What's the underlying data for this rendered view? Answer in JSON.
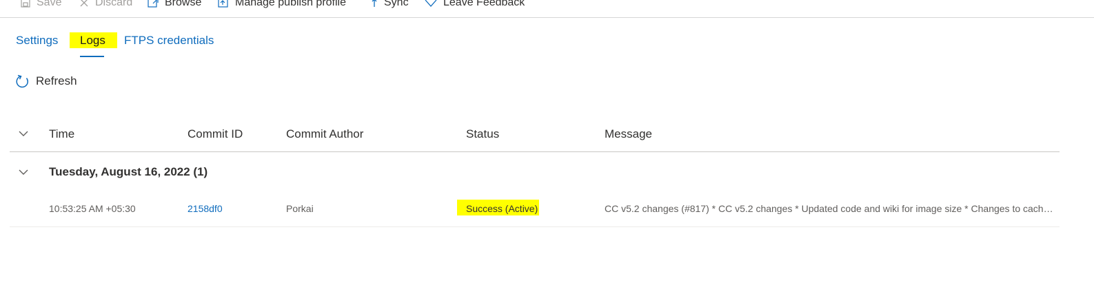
{
  "toolbar": {
    "items": [
      {
        "label": "Save",
        "icon": "save-icon",
        "enabled": false
      },
      {
        "label": "Discard",
        "icon": "discard-icon",
        "enabled": false
      },
      {
        "label": "Browse",
        "icon": "browse-icon",
        "enabled": true
      },
      {
        "label": "Manage publish profile",
        "icon": "publish-profile-icon",
        "enabled": true
      },
      {
        "label": "Sync",
        "icon": "sync-icon",
        "enabled": true
      },
      {
        "label": "Leave Feedback",
        "icon": "heart-icon",
        "enabled": true
      }
    ]
  },
  "tabs": [
    {
      "label": "Settings",
      "selected": false
    },
    {
      "label": "Logs",
      "selected": true,
      "highlighted": true
    },
    {
      "label": "FTPS credentials",
      "selected": false
    }
  ],
  "actions": {
    "refresh_label": "Refresh",
    "refresh_icon": "refresh-icon"
  },
  "table": {
    "columns": [
      "Time",
      "Commit ID",
      "Commit Author",
      "Status",
      "Message"
    ],
    "groups": [
      {
        "title": "Tuesday, August 16, 2022 (1)",
        "expanded": true,
        "rows": [
          {
            "time": "10:53:25 AM +05:30",
            "commit_id": "2158df0",
            "author": "Porkai",
            "status": "Success (Active)",
            "message": "CC v5.2 changes (#817) * CC v5.2 changes * Updated code and wiki for image size * Changes to cache ..."
          }
        ]
      }
    ]
  },
  "colors": {
    "link": "#0f6cbd",
    "highlight": "#ffff00",
    "text": "#323130",
    "muted": "#605e5c"
  }
}
